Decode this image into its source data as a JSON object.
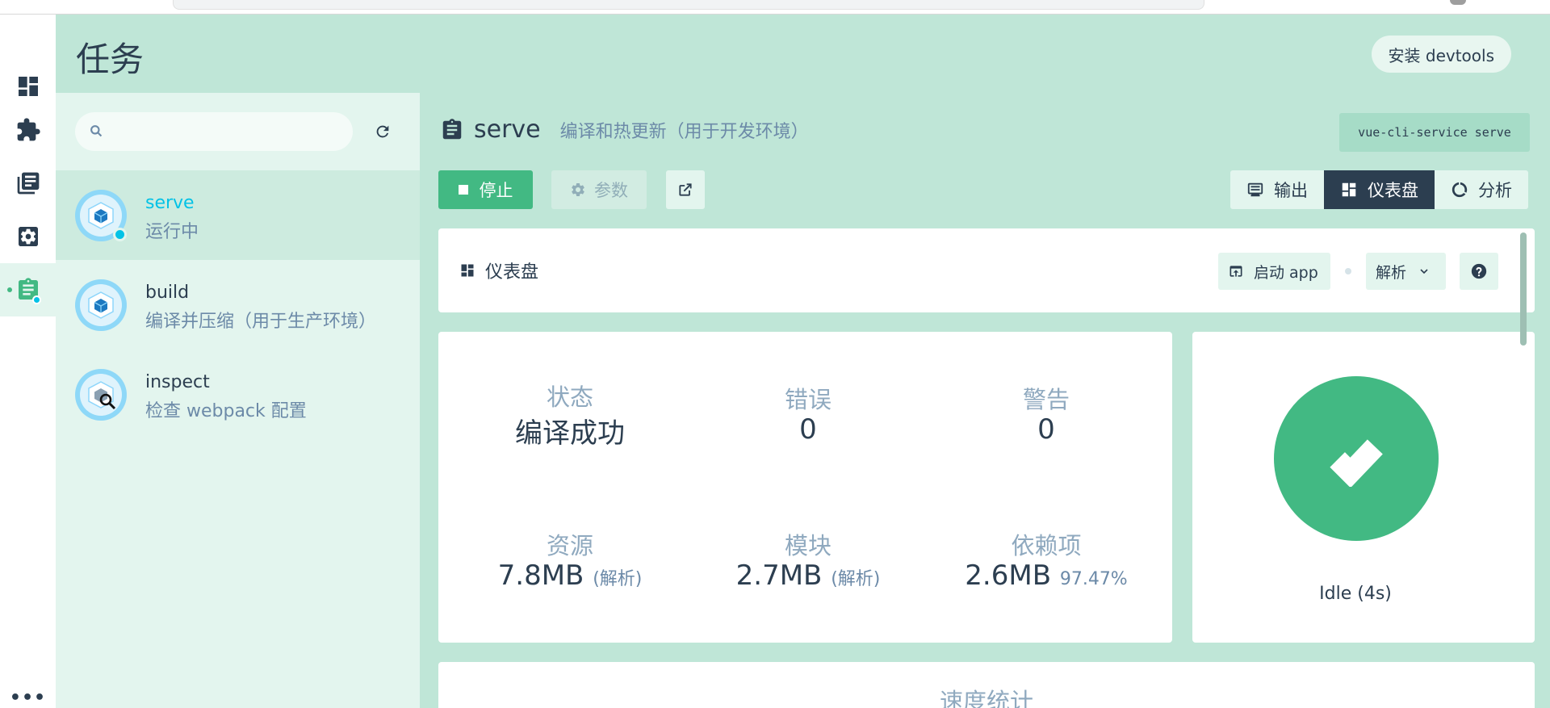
{
  "page": {
    "title": "任务",
    "devtools_label": "安装 devtools"
  },
  "rail": {
    "items": [
      {
        "name": "dashboard",
        "icon": "dashboard-icon"
      },
      {
        "name": "plugins",
        "icon": "puzzle-icon"
      },
      {
        "name": "dependencies",
        "icon": "library-books-icon"
      },
      {
        "name": "configuration",
        "icon": "settings-icon"
      },
      {
        "name": "tasks",
        "icon": "assignment-icon",
        "active": true
      }
    ],
    "more_label": "•••"
  },
  "search": {
    "placeholder": "",
    "value": ""
  },
  "tasks": [
    {
      "name": "serve",
      "description": "运行中",
      "selected": true
    },
    {
      "name": "build",
      "description": "编译并压缩（用于生产环境）"
    },
    {
      "name": "inspect",
      "description": "检查 webpack 配置"
    }
  ],
  "task_detail": {
    "name": "serve",
    "description": "编译和热更新（用于开发环境）",
    "command": "vue-cli-service serve",
    "stop_label": "停止",
    "params_label": "参数"
  },
  "views": [
    {
      "label": "输出",
      "icon": "monitor-icon"
    },
    {
      "label": "仪表盘",
      "icon": "dashboard-icon",
      "active": true
    },
    {
      "label": "分析",
      "icon": "donut-icon"
    }
  ],
  "dashboard": {
    "title": "仪表盘",
    "launch_label": "启动 app",
    "parse_label": "解析"
  },
  "stats": {
    "status": {
      "label": "状态",
      "value": "编译成功"
    },
    "errors": {
      "label": "错误",
      "value": "0"
    },
    "warnings": {
      "label": "警告",
      "value": "0"
    },
    "assets": {
      "label": "资源",
      "value": "7.8MB",
      "sub": "(解析)"
    },
    "modules": {
      "label": "模块",
      "value": "2.7MB",
      "sub": "(解析)"
    },
    "dependencies": {
      "label": "依赖项",
      "value": "2.6MB",
      "sub": "97.47%"
    }
  },
  "status_panel": {
    "text": "Idle (4s)"
  },
  "speed": {
    "title": "速度统计"
  },
  "colors": {
    "accent": "#42b983",
    "dark": "#2c3e50",
    "running": "#03c2e6",
    "background": "#bfe6d7"
  }
}
